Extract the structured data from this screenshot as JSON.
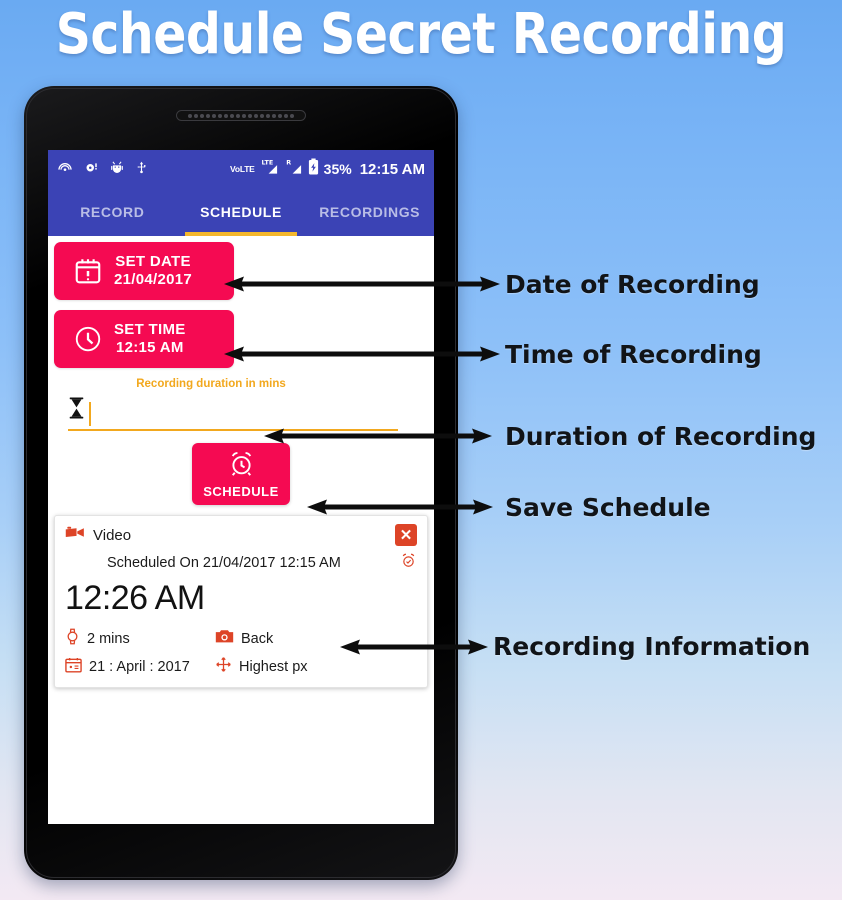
{
  "page": {
    "title": "Schedule Secret Recording",
    "bg_top_color": "#6aaaf2",
    "bg_bottom_color": "#f3e9f3"
  },
  "statusbar": {
    "icons": [
      "cast-icon",
      "alarm-icon",
      "android-debug-icon",
      "usb-icon"
    ],
    "volte": "VoLTE",
    "lte_label": "LTE",
    "roaming_label": "R",
    "battery": "charging-battery-icon",
    "battery_percent": "35%",
    "clock": "12:15 AM"
  },
  "tabs": [
    {
      "label": "RECORD",
      "active": false
    },
    {
      "label": "SCHEDULE",
      "active": true
    },
    {
      "label": "RECORDINGS",
      "active": false
    }
  ],
  "schedule_form": {
    "set_date": {
      "icon": "calendar-alert-icon",
      "label": "SET DATE",
      "value": "21/04/2017"
    },
    "set_time": {
      "icon": "clock-icon",
      "label": "SET TIME",
      "value": "12:15 AM"
    },
    "duration": {
      "label": "Recording duration in mins",
      "icon": "hourglass-icon",
      "value": "",
      "placeholder": ""
    },
    "schedule_button": {
      "icon": "alarm-clock-icon",
      "label": "SCHEDULE"
    }
  },
  "info_card": {
    "type_icon": "video-camera-icon",
    "type_label": "Video",
    "close_label": "✕",
    "scheduled_on": "Scheduled On 21/04/2017  12:15 AM",
    "alarm_icon": "alarm-check-icon",
    "big_time": "12:26 AM",
    "details": [
      {
        "icon": "watch-icon",
        "text": "2 mins"
      },
      {
        "icon": "camera-icon",
        "text": "Back"
      },
      {
        "icon": "calendar-date-icon",
        "text": "21 : April : 2017"
      },
      {
        "icon": "resolution-move-icon",
        "text": "Highest px"
      }
    ]
  },
  "annotations": [
    {
      "label": "Date of Recording"
    },
    {
      "label": "Time of Recording"
    },
    {
      "label": "Duration of Recording"
    },
    {
      "label": "Save Schedule"
    },
    {
      "label": "Recording Information"
    }
  ],
  "colors": {
    "accent_pink": "#f50a52",
    "primary_blue": "#3b43b5",
    "amber": "#f2a81e",
    "card_orange": "#dd4427"
  }
}
